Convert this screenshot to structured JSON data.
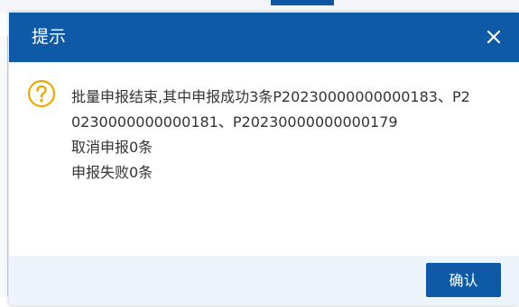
{
  "dialog": {
    "title": "提示",
    "close_icon": "close-icon",
    "warning_icon": "question-circle-icon",
    "message_lines": [
      "批量申报结束,其中申报成功3条P20230000000000183、P2",
      "0230000000000181、P20230000000000179",
      "取消申报0条",
      "申报失败0条"
    ],
    "confirm_label": "确认"
  },
  "colors": {
    "header_bg": "#0e5aa7",
    "button_bg": "#0e5aa7",
    "footer_bg": "#eef4fb",
    "warning_icon": "#f0a800",
    "text": "#333333"
  }
}
